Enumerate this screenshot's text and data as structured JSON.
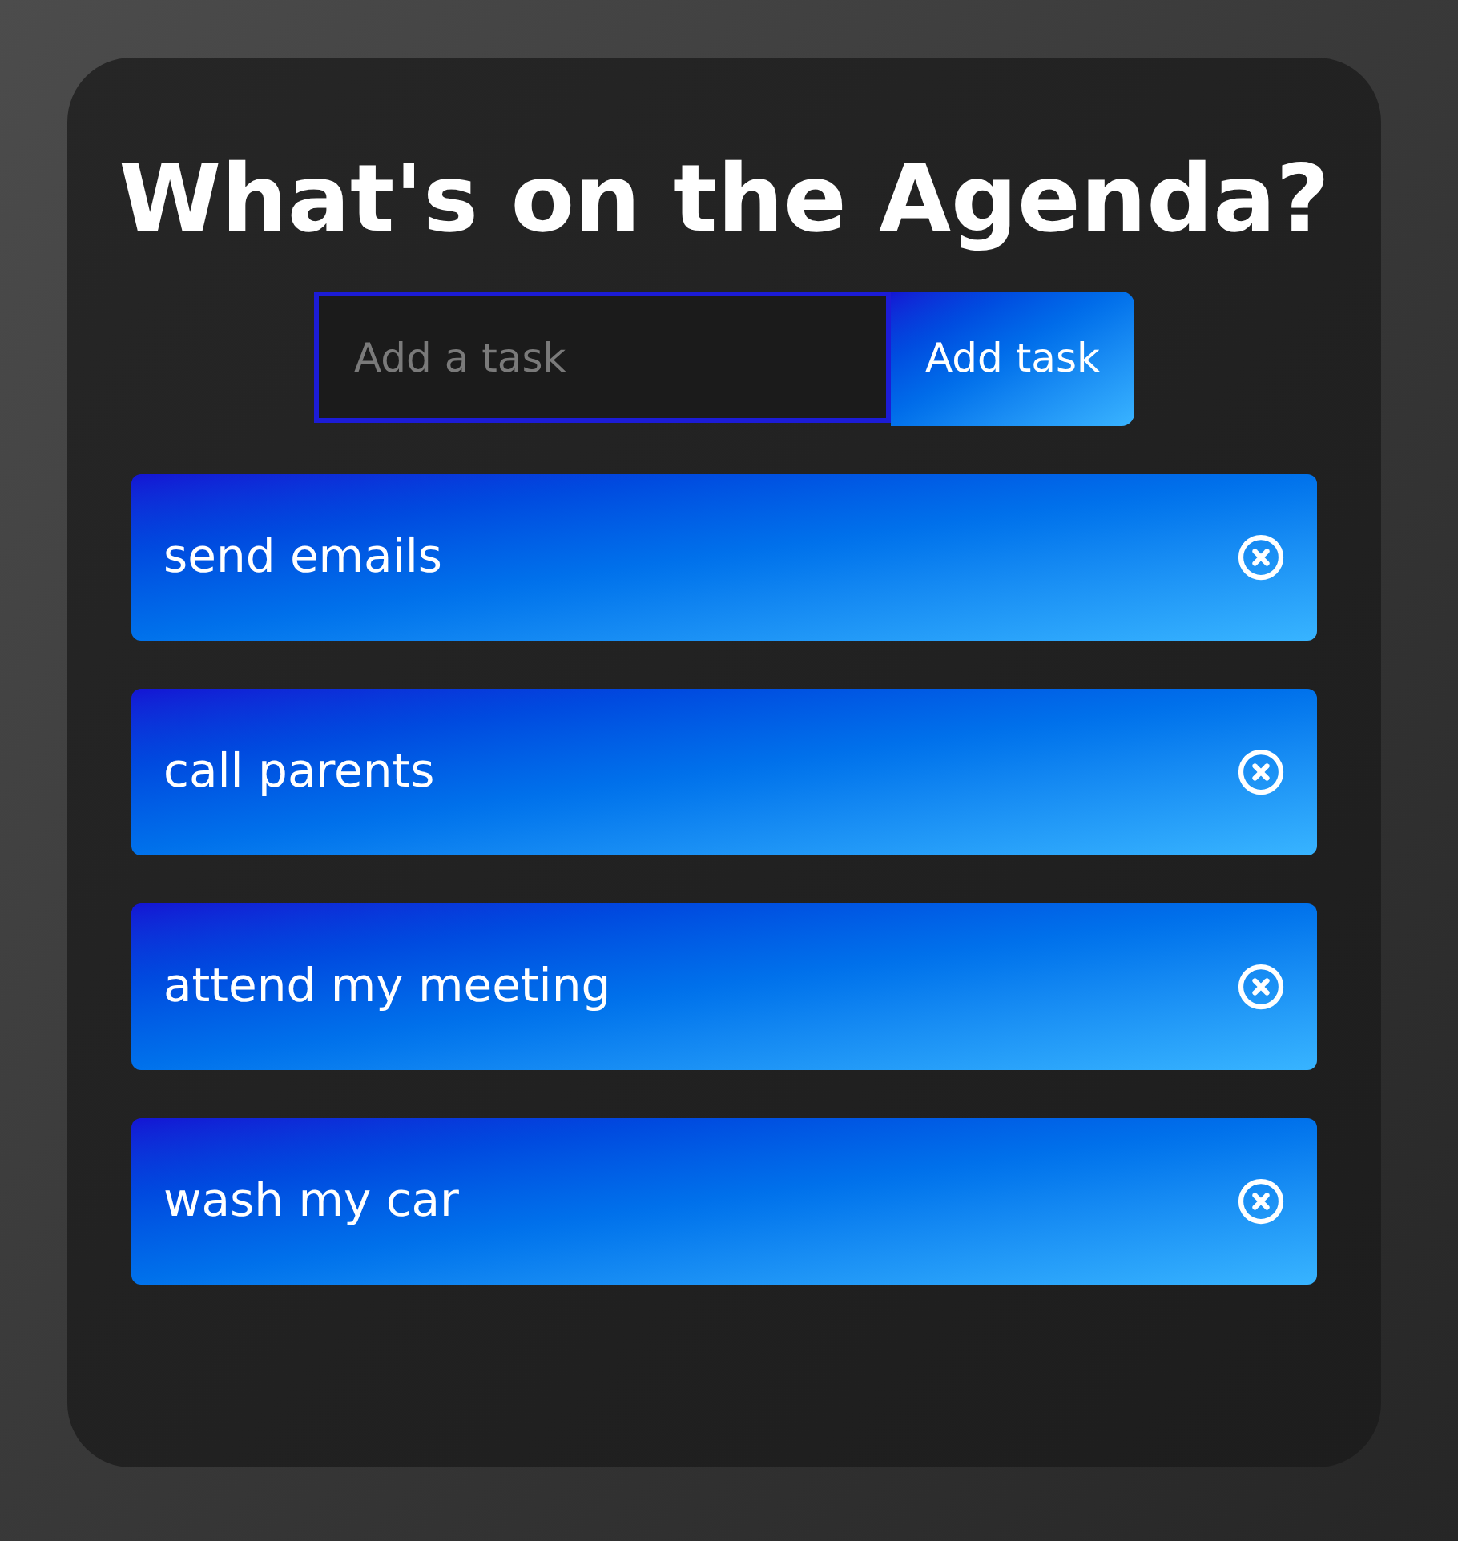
{
  "title": "What's on the Agenda?",
  "new_task": {
    "placeholder": "Add a task",
    "button": "Add task"
  },
  "tasks": [
    {
      "text": "send emails"
    },
    {
      "text": "call parents"
    },
    {
      "text": "attend my meeting"
    },
    {
      "text": "wash my car"
    }
  ]
}
